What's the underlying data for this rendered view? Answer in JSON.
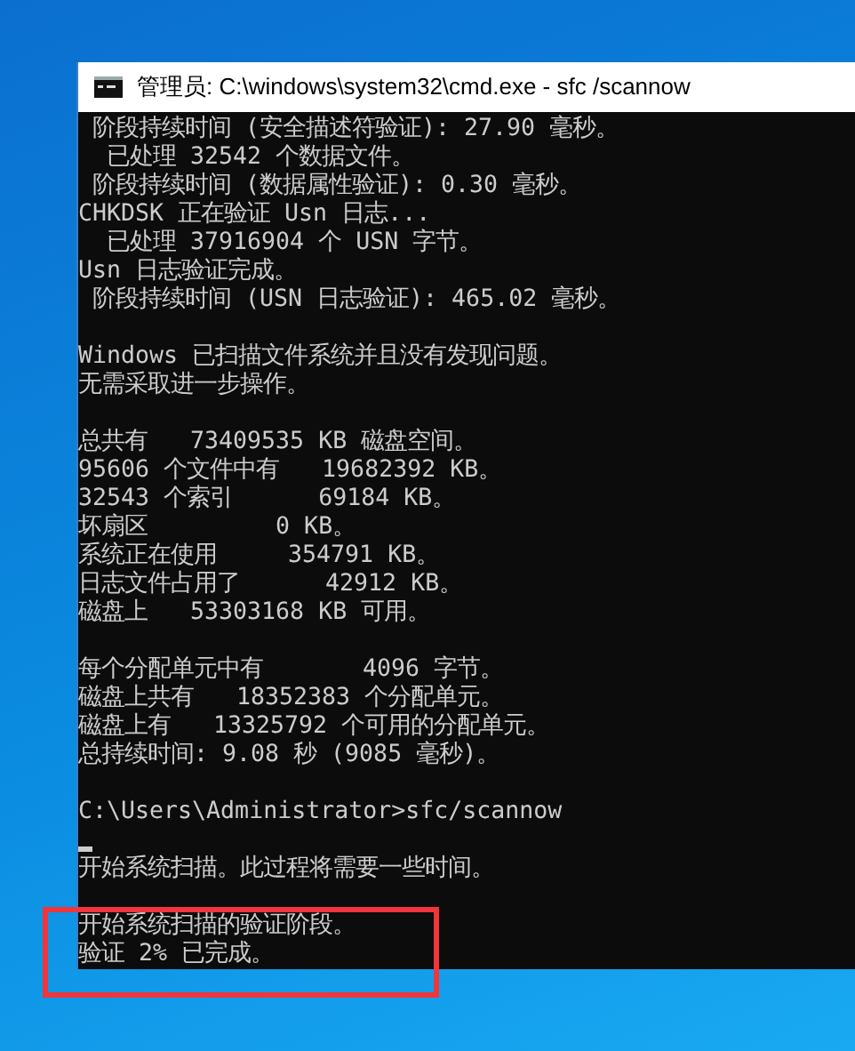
{
  "window": {
    "title": "管理员: C:\\windows\\system32\\cmd.exe - sfc /scannow"
  },
  "console": {
    "lines": [
      {
        "kind": "text",
        "text": " 阶段持续时间 (安全描述符验证): 27.90 毫秒。",
        "highlighted": false
      },
      {
        "kind": "text",
        "text": "  已处理 32542 个数据文件。",
        "highlighted": false
      },
      {
        "kind": "text",
        "text": " 阶段持续时间 (数据属性验证): 0.30 毫秒。",
        "highlighted": false
      },
      {
        "kind": "text",
        "text": "CHKDSK 正在验证 Usn 日志...",
        "highlighted": false
      },
      {
        "kind": "text",
        "text": "  已处理 37916904 个 USN 字节。",
        "highlighted": false
      },
      {
        "kind": "text",
        "text": "Usn 日志验证完成。",
        "highlighted": false
      },
      {
        "kind": "text",
        "text": " 阶段持续时间 (USN 日志验证): 465.02 毫秒。",
        "highlighted": false
      },
      {
        "kind": "blank"
      },
      {
        "kind": "text",
        "text": "Windows 已扫描文件系统并且没有发现问题。",
        "highlighted": false
      },
      {
        "kind": "text",
        "text": "无需采取进一步操作。",
        "highlighted": false
      },
      {
        "kind": "blank"
      },
      {
        "kind": "text",
        "text": "总共有   73409535 KB 磁盘空间。",
        "highlighted": false
      },
      {
        "kind": "text",
        "text": "95606 个文件中有   19682392 KB。",
        "highlighted": false
      },
      {
        "kind": "text",
        "text": "32543 个索引      69184 KB。",
        "highlighted": false
      },
      {
        "kind": "text",
        "text": "坏扇区         0 KB。",
        "highlighted": false
      },
      {
        "kind": "text",
        "text": "系统正在使用     354791 KB。",
        "highlighted": false
      },
      {
        "kind": "text",
        "text": "日志文件占用了      42912 KB。",
        "highlighted": false
      },
      {
        "kind": "text",
        "text": "磁盘上   53303168 KB 可用。",
        "highlighted": false
      },
      {
        "kind": "blank"
      },
      {
        "kind": "text",
        "text": "每个分配单元中有       4096 字节。",
        "highlighted": false
      },
      {
        "kind": "text",
        "text": "磁盘上共有   18352383 个分配单元。",
        "highlighted": false
      },
      {
        "kind": "text",
        "text": "磁盘上有   13325792 个可用的分配单元。",
        "highlighted": false
      },
      {
        "kind": "text",
        "text": "总持续时间: 9.08 秒 (9085 毫秒)。",
        "highlighted": false
      },
      {
        "kind": "blank"
      },
      {
        "kind": "text",
        "text": "C:\\Users\\Administrator>sfc/scannow",
        "highlighted": false
      },
      {
        "kind": "cursor"
      },
      {
        "kind": "text",
        "text": "开始系统扫描。此过程将需要一些时间。",
        "highlighted": false
      },
      {
        "kind": "blank"
      },
      {
        "kind": "text",
        "text": "开始系统扫描的验证阶段。",
        "highlighted": true
      },
      {
        "kind": "text",
        "text": "验证 2% 已完成。",
        "highlighted": true
      }
    ]
  }
}
